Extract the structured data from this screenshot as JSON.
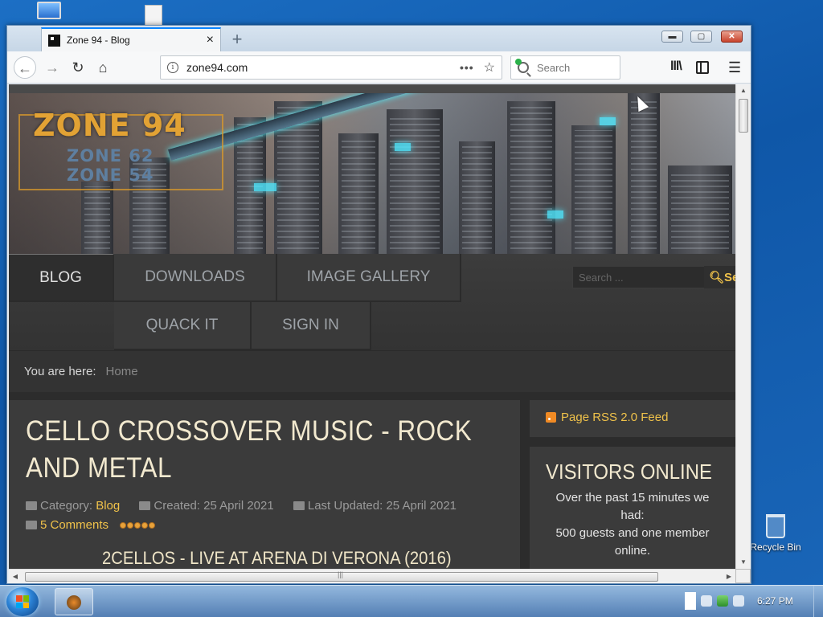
{
  "desktop": {
    "recycle_bin_label": "Recycle Bin"
  },
  "browser": {
    "tab_title": "Zone 94 - Blog",
    "new_tab_symbol": "+",
    "tab_close_symbol": "×",
    "url": "zone94.com",
    "url_info_symbol": "i",
    "url_menu_symbol": "•••",
    "bookmark_star_symbol": "☆",
    "search_placeholder": "Search",
    "back_symbol": "←",
    "forward_symbol": "→",
    "reload_symbol": "↻",
    "home_symbol": "⌂",
    "library_symbol": "lll\\",
    "menu_symbol": "☰",
    "window_buttons": {
      "minimize": "▬",
      "maximize": "▢",
      "close": "✕"
    }
  },
  "site": {
    "logo": {
      "main": "ZONE 94",
      "sub1": "ZONE 62",
      "sub2": "ZONE 54"
    },
    "menu": {
      "blog": "BLOG",
      "downloads": "DOWNLOADS",
      "gallery": "IMAGE GALLERY",
      "quack": "QUACK IT",
      "signin": "SIGN IN"
    },
    "search_placeholder": "Search ...",
    "search_button": "Se",
    "breadcrumb": {
      "label": "You are here:",
      "home": "Home"
    },
    "article": {
      "title": "CELLO CROSSOVER MUSIC - ROCK AND METAL",
      "category_label": "Category:",
      "category": "Blog",
      "created": "Created: 25 April 2021",
      "updated": "Last Updated: 25 April 2021",
      "comments": "5 Comments",
      "rating_stars": 5,
      "video_title": "2CELLOS - LIVE AT ARENA DI VERONA (2016)"
    },
    "sidebar": {
      "rss": "Page RSS 2.0 Feed",
      "visitors_title": "VISITORS ONLINE",
      "visitors_text_1": "Over the past 15 minutes we had:",
      "visitors_text_2": "500 guests and one member online."
    }
  },
  "taskbar": {
    "clock": "6:27 PM"
  },
  "colors": {
    "accent_gold": "#f0c24a",
    "logo_orange": "#e2a234",
    "page_bg": "#3b3b3b",
    "tab_accent": "#0a84ff"
  }
}
